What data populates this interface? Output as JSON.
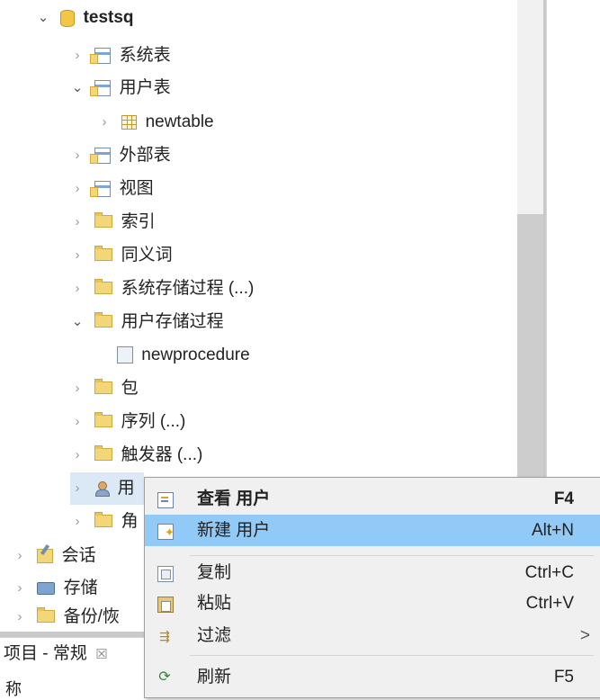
{
  "tree": {
    "root": "testsq",
    "items": [
      {
        "label": "系统表"
      },
      {
        "label": "用户表"
      },
      {
        "label": "newtable"
      },
      {
        "label": "外部表"
      },
      {
        "label": "视图"
      },
      {
        "label": "索引"
      },
      {
        "label": "同义词"
      },
      {
        "label": "系统存储过程 (...)"
      },
      {
        "label": "用户存储过程"
      },
      {
        "label": "newprocedure"
      },
      {
        "label": "包"
      },
      {
        "label": "序列 (...)"
      },
      {
        "label": "触发器 (...)"
      },
      {
        "label": "用"
      },
      {
        "label": "角"
      },
      {
        "label": "会话"
      },
      {
        "label": "存储"
      },
      {
        "label": "备份/恢"
      }
    ]
  },
  "bottom_panel": {
    "tab_label": "项目 - 常规",
    "close_glyph": "☒",
    "column_text": "称"
  },
  "context_menu": {
    "items": [
      {
        "label": "查看 用户",
        "shortcut": "F4",
        "icon": "view-user-icon"
      },
      {
        "label": "新建 用户",
        "shortcut": "Alt+N",
        "icon": "new-user-icon"
      },
      {
        "label": "复制",
        "shortcut": "Ctrl+C",
        "icon": "copy-icon"
      },
      {
        "label": "粘贴",
        "shortcut": "Ctrl+V",
        "icon": "paste-icon"
      },
      {
        "label": "过滤",
        "submenu": ">",
        "icon": "filter-icon"
      },
      {
        "label": "刷新",
        "shortcut": "F5",
        "icon": "refresh-icon"
      }
    ]
  },
  "colors": {
    "menu_highlight": "#91c9f7",
    "menu_background": "#f0f0f0",
    "folder": "#f2d77a"
  }
}
